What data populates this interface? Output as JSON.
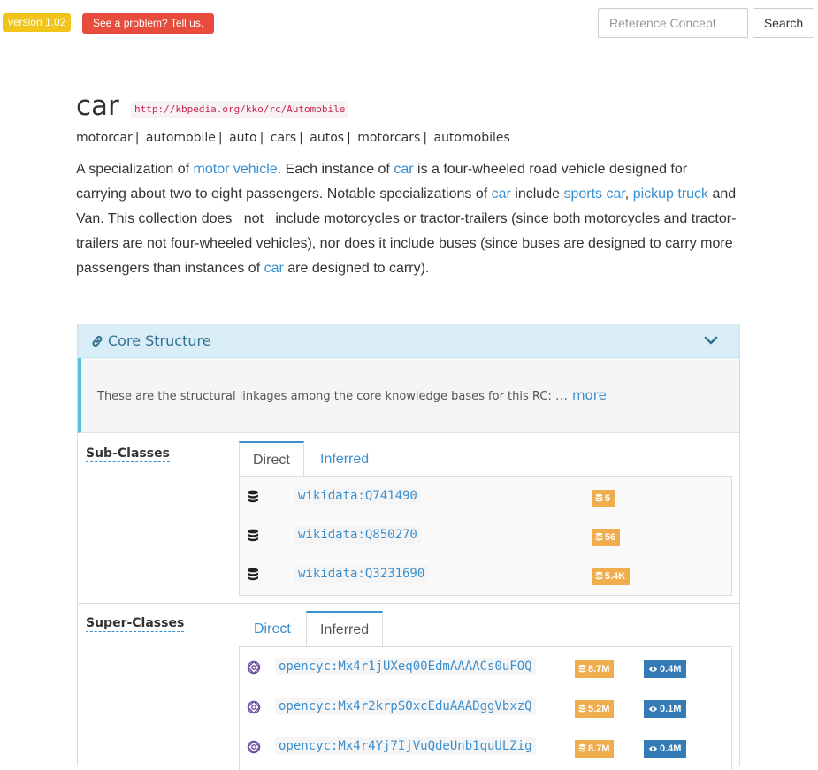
{
  "header": {
    "version_label": "version 1.02",
    "problem_button": "See a problem? Tell us.",
    "search_placeholder": "Reference Concept",
    "search_button": "Search"
  },
  "concept": {
    "title": "car",
    "uri": "http://kbpedia.org/kko/rc/Automobile",
    "alt_labels": [
      "motorcar",
      "automobile",
      "auto",
      "cars",
      "autos",
      "motorcars",
      "automobiles"
    ],
    "definition": {
      "p1": "A specialization of ",
      "link_motor_vehicle": "motor vehicle",
      "p2": ". Each instance of ",
      "link_car_1": "car",
      "p3": " is a four-wheeled road vehicle designed for carrying about two to eight passengers. Notable specializations of ",
      "link_car_2": "car",
      "p4": " include ",
      "link_sports_car": "sports car",
      "p5": ", ",
      "link_pickup_truck": "pickup truck",
      "p6": " and Van. This collection does _not_ include motorcycles or tractor-trailers (since both motorcycles and tractor-trailers are not four-wheeled vehicles), nor does it include buses (since buses are designed to carry more passengers than instances of ",
      "link_car_3": "car",
      "p7": " are designed to carry)."
    }
  },
  "core_structure": {
    "title": "Core Structure",
    "intro": "These are the structural linkages among the core knowledge bases for this RC: ",
    "more_link": "... more",
    "sub_classes": {
      "label": "Sub-Classes",
      "tabs": [
        "Direct",
        "Inferred"
      ],
      "active_tab": "Direct",
      "items": [
        {
          "id": "wikidata:Q741490",
          "count": "5"
        },
        {
          "id": "wikidata:Q850270",
          "count": "56"
        },
        {
          "id": "wikidata:Q3231690",
          "count": "5.4K"
        }
      ]
    },
    "super_classes": {
      "label": "Super-Classes",
      "tabs": [
        "Direct",
        "Inferred"
      ],
      "active_tab": "Inferred",
      "items": [
        {
          "id": "opencyc:Mx4r1jUXeq00EdmAAAACs0uFOQ",
          "count": "8.7M",
          "views": "0.4M"
        },
        {
          "id": "opencyc:Mx4r2krpSOxcEduAAADggVbxzQ",
          "count": "5.2M",
          "views": "0.1M"
        },
        {
          "id": "opencyc:Mx4r4Yj7IjVuQdeUnb1quULZig",
          "count": "8.7M",
          "views": "0.4M"
        }
      ]
    }
  },
  "colors": {
    "link": "#3a8fd0",
    "version_badge": "#f0c419",
    "problem_button": "#e74c3c",
    "count_badge": "#f0ad4e",
    "view_badge": "#337ab7",
    "panel_heading": "#d9edf7"
  },
  "icons": {
    "database": "database-icon",
    "opencyc": "opencyc-icon",
    "eye": "eye-icon",
    "link": "link-icon",
    "chevron": "chevron-down-icon"
  }
}
